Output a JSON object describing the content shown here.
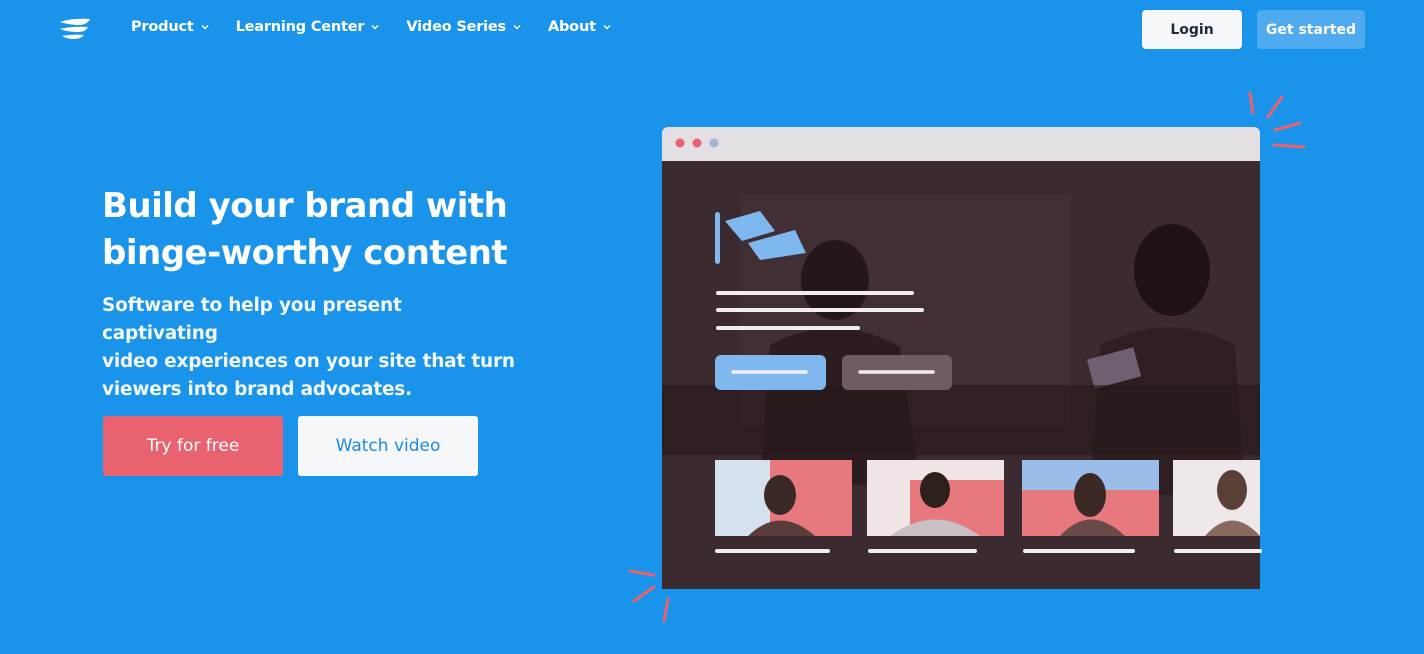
{
  "nav": {
    "items": [
      {
        "label": "Product"
      },
      {
        "label": "Learning Center"
      },
      {
        "label": "Video Series"
      },
      {
        "label": "About"
      }
    ],
    "login_label": "Login",
    "get_started_label": "Get started"
  },
  "hero": {
    "headline_line1": "Build your brand with",
    "headline_line2": "binge-worthy content",
    "subtitle_line1": "Software to help you present captivating",
    "subtitle_line2": "video experiences on your site that turn",
    "subtitle_line3": "viewers into brand advocates.",
    "primary_cta": "Try for free",
    "secondary_cta": "Watch video"
  },
  "colors": {
    "background": "#1a93ea",
    "primary_button": "#e8636f",
    "secondary_button": "#f6f7fb",
    "accent_text": "#1f8ae0"
  }
}
